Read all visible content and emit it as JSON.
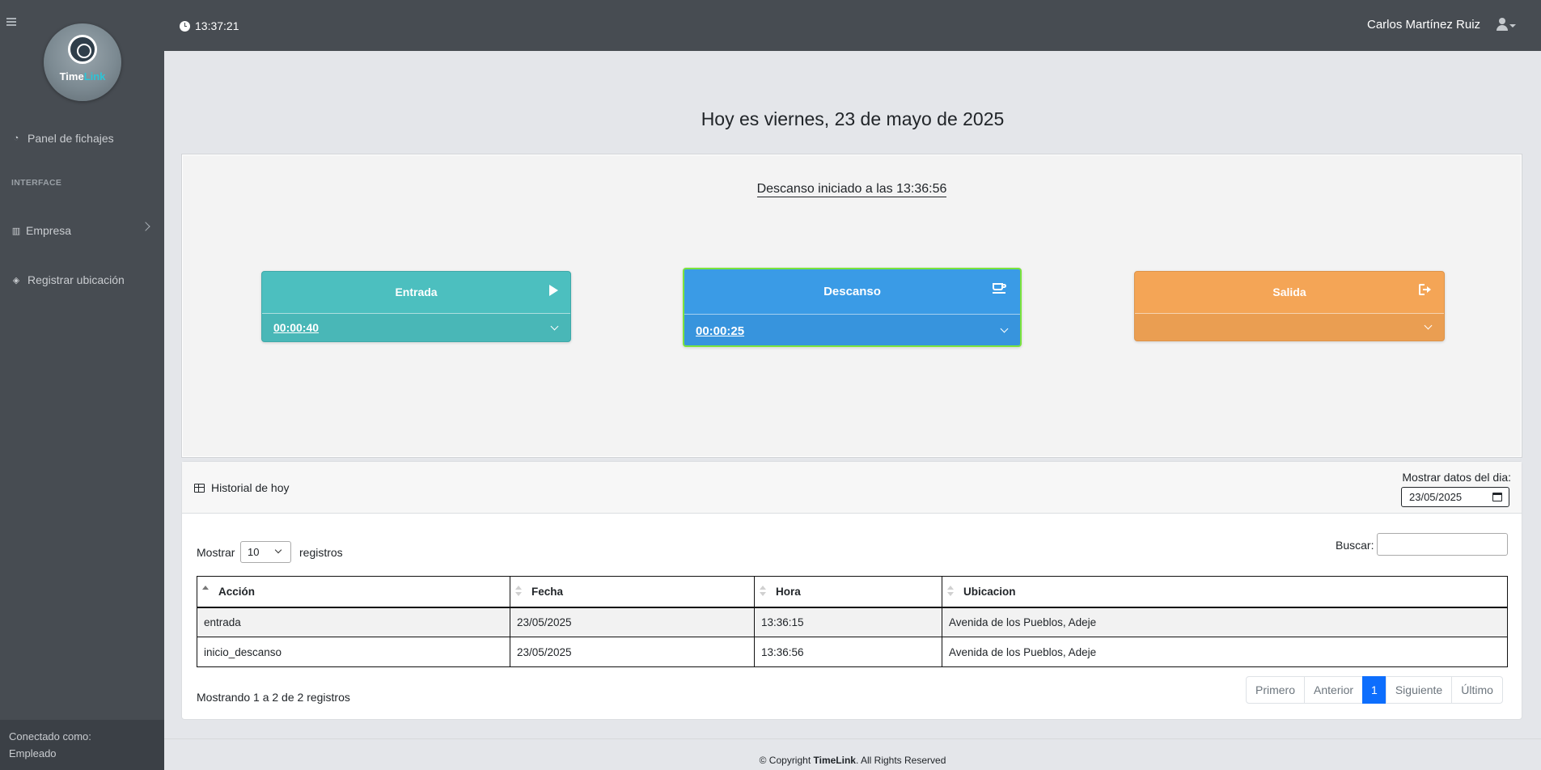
{
  "sidebar": {
    "logo": {
      "word_a": "Time",
      "word_b": "Link"
    },
    "items": [
      {
        "label": "Panel de fichajes",
        "icon": "gauge-icon"
      },
      {
        "label": "Empresa",
        "icon": "building-icon"
      },
      {
        "label": "Registrar ubicación",
        "icon": "location-icon"
      }
    ],
    "heading": "INTERFACE",
    "footer": {
      "line1": "Conectado como:",
      "line2": "Empleado"
    }
  },
  "topbar": {
    "clock": "13:37:21",
    "user_name": "Carlos Martínez Ruiz"
  },
  "main": {
    "date_title": "Hoy es viernes, 23 de mayo de 2025",
    "status": "Descanso iniciado a las 13:36:56",
    "cards": {
      "entrada": {
        "label": "Entrada",
        "time": "00:00:40",
        "color": "#4cbfbf"
      },
      "descanso": {
        "label": "Descanso",
        "time": "00:00:25",
        "color": "#3a9be6",
        "highlight": "#7be33c"
      },
      "salida": {
        "label": "Salida",
        "time": "",
        "color": "#f4a556"
      }
    }
  },
  "history": {
    "title": "Historial de hoy",
    "day_label": "Mostrar datos del dia:",
    "day_value": "23/05/2025",
    "length": {
      "before": "Mostrar",
      "value": "10",
      "after": "registros"
    },
    "search_label": "Buscar:",
    "search_value": "",
    "columns": [
      "Acción",
      "Fecha",
      "Hora",
      "Ubicacion"
    ],
    "rows": [
      [
        "entrada",
        "23/05/2025",
        "13:36:15",
        "Avenida de los Pueblos, Adeje"
      ],
      [
        "inicio_descanso",
        "23/05/2025",
        "13:36:56",
        "Avenida de los Pueblos, Adeje"
      ]
    ],
    "info": "Mostrando 1 a 2 de 2 registros",
    "pager": {
      "first": "Primero",
      "prev": "Anterior",
      "current": "1",
      "next": "Siguiente",
      "last": "Último"
    }
  },
  "footer": {
    "prefix": "© Copyright",
    "brand": "TimeLink",
    "suffix": ". All Rights Reserved"
  }
}
